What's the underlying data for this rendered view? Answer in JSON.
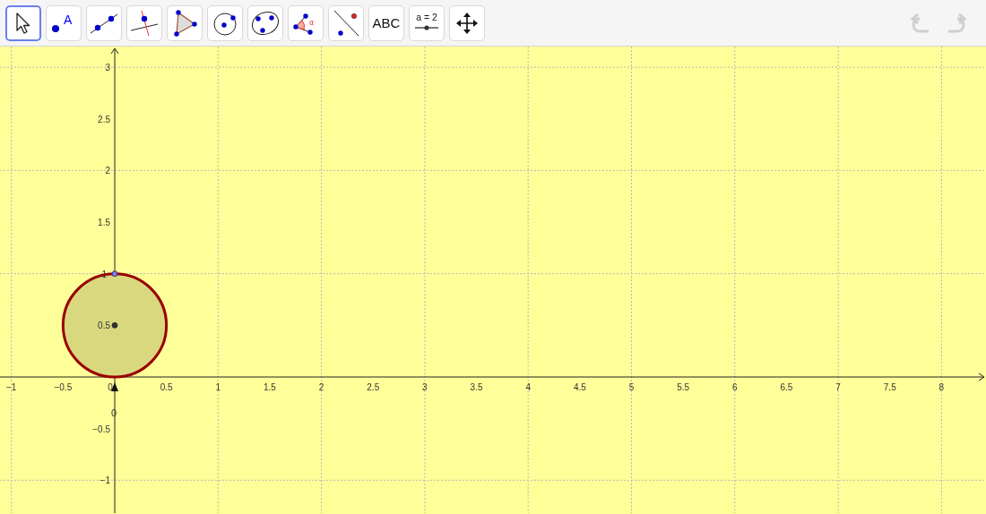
{
  "toolbar": {
    "tools": [
      {
        "kind": "move",
        "selected": true
      },
      {
        "kind": "point",
        "selected": false,
        "label": "A"
      },
      {
        "kind": "line",
        "selected": false
      },
      {
        "kind": "perpendicular",
        "selected": false
      },
      {
        "kind": "polygon",
        "selected": false
      },
      {
        "kind": "circle",
        "selected": false
      },
      {
        "kind": "conic",
        "selected": false
      },
      {
        "kind": "angle",
        "selected": false,
        "label": "α"
      },
      {
        "kind": "reflect",
        "selected": false
      },
      {
        "kind": "text",
        "selected": false,
        "label": "ABC"
      },
      {
        "kind": "slider",
        "selected": false,
        "label": "a = 2"
      },
      {
        "kind": "pan",
        "selected": false
      }
    ],
    "undo": {
      "disabled": true
    },
    "redo": {
      "disabled": true
    }
  },
  "graphics": {
    "x_labels": [
      "−1",
      "−0.5",
      "0",
      "0.5",
      "1",
      "1.5",
      "2",
      "2.5",
      "3",
      "3.5",
      "4",
      "4.5",
      "5",
      "5.5",
      "6",
      "6.5",
      "7",
      "7.5",
      "8"
    ],
    "y_labels": [
      "3",
      "2.5",
      "2",
      "1.5",
      "1",
      "0.5",
      "−0.5",
      "−1"
    ],
    "points": [
      {
        "kind": "center",
        "color": "#333333"
      },
      {
        "kind": "on-circle",
        "color": "#7c7cff"
      }
    ],
    "origin_marker": {
      "label": "0"
    }
  }
}
